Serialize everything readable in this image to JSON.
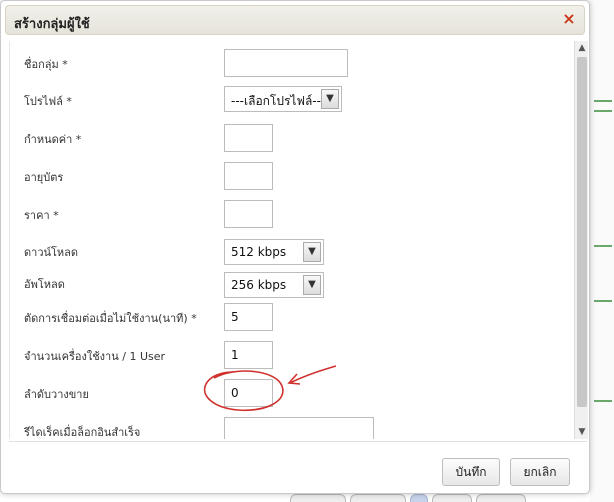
{
  "dialog": {
    "title": "สร้างกลุ่มผู้ใช้",
    "close_icon": "close-icon",
    "close_symbol": "×"
  },
  "form": {
    "group_name": {
      "label": "ชื่อกลุ่ม *",
      "value": ""
    },
    "profile": {
      "label": "โปรไฟล์ *",
      "selected": "---เลือกโปรไฟล์---"
    },
    "duration": {
      "label": "กำหนดค่า *",
      "value": ""
    },
    "validity": {
      "label": "อายุบัตร",
      "value": ""
    },
    "price": {
      "label": "ราคา *",
      "value": ""
    },
    "download": {
      "label": "ดาวน์โหลด",
      "selected": "512 kbps"
    },
    "upload": {
      "label": "อัพโหลด",
      "selected": "256 kbps"
    },
    "idle_timeout": {
      "label": "ตัดการเชื่อมต่อเมื่อไม่ใช้งาน(นาที) *",
      "value": "5"
    },
    "devices": {
      "label": "จำนวนเครื่องใช้งาน / 1 User",
      "value": "1"
    },
    "sort_order": {
      "label": "ลำดับวางขาย",
      "value": "0"
    },
    "redirect": {
      "label": "รีไดเร็คเมื่อล็อกอินสำเร็จ",
      "value": ""
    }
  },
  "footer": {
    "save_label": "บันทึก",
    "cancel_label": "ยกเลิก"
  },
  "icons": {
    "dropdown": "chevron-down-icon",
    "scroll_up": "scroll-up-icon",
    "scroll_down": "scroll-down-icon"
  },
  "colors": {
    "close": "#c83a1a",
    "annotation": "#d0312d"
  }
}
